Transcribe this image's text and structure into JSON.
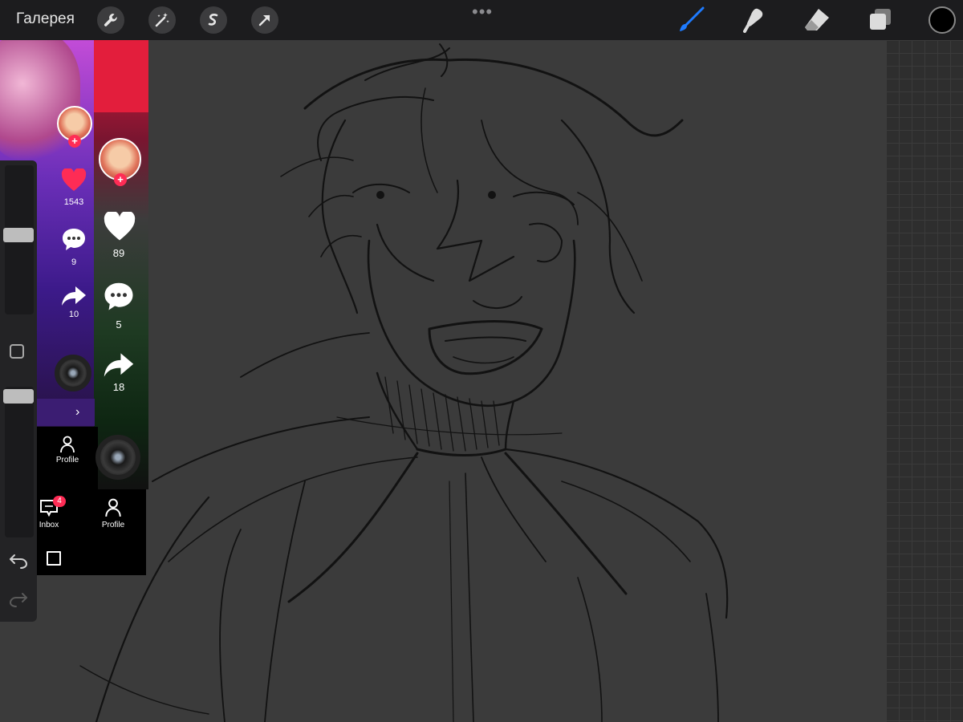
{
  "toolbar": {
    "gallery_label": "Галерея",
    "left_tools": [
      "wrench-icon",
      "magic-wand-icon",
      "selection-icon",
      "transform-arrow-icon"
    ],
    "more_label": "•••",
    "right_tools": [
      "brush-icon",
      "smudge-icon",
      "eraser-icon",
      "layers-icon"
    ],
    "active_tool": "brush-icon",
    "accent_color": "#1e7bff",
    "current_color": "#000000"
  },
  "overlay_left": {
    "likes": "1543",
    "comments": "9",
    "shares": "10",
    "nav_profile": "Profile",
    "nav_inbox": "Inbox",
    "inbox_badge": "4"
  },
  "overlay_right": {
    "likes": "89",
    "comments": "5",
    "shares": "18",
    "nav_profile": "Profile"
  },
  "colors": {
    "like_red": "#fe2c55",
    "canvas_bg": "#3b3b3b"
  }
}
